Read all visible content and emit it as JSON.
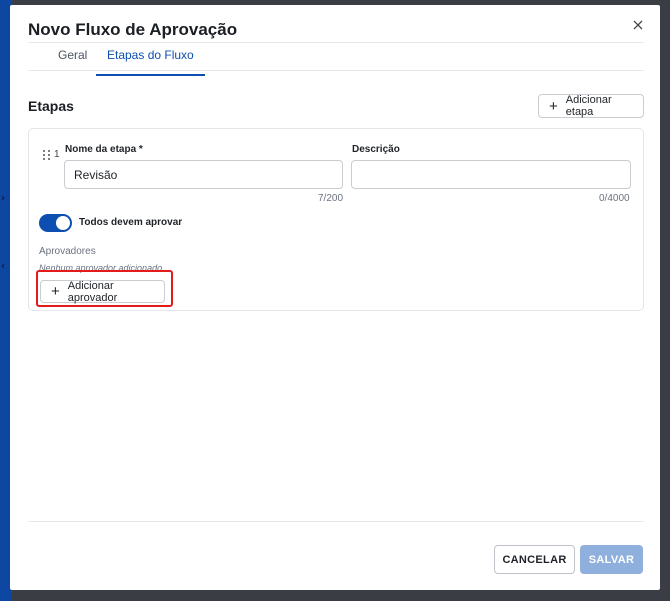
{
  "dialog": {
    "title": "Novo Fluxo de Aprovação",
    "close_icon": "close-icon"
  },
  "tabs": [
    {
      "label": "Geral",
      "active": false
    },
    {
      "label": "Etapas do Fluxo",
      "active": true
    }
  ],
  "section": {
    "title": "Etapas",
    "add_step_label": "Adicionar etapa"
  },
  "step": {
    "number": "1",
    "name_label": "Nome da etapa *",
    "name_value": "Revisão",
    "name_counter": "7/200",
    "description_label": "Descrição",
    "description_value": "",
    "description_counter": "0/4000",
    "all_must_approve_label": "Todos devem aprovar",
    "all_must_approve": true,
    "approvers_label": "Aprovadores",
    "approvers_empty": "Nenhum aprovador adicionado.",
    "add_approver_label": "Adicionar aprovador"
  },
  "footer": {
    "cancel_label": "CANCELAR",
    "save_label": "SALVAR",
    "save_enabled": false
  },
  "colors": {
    "primary": "#0d4fb0",
    "save_disabled": "#8fb0dd",
    "highlight": "#e31b1b"
  }
}
